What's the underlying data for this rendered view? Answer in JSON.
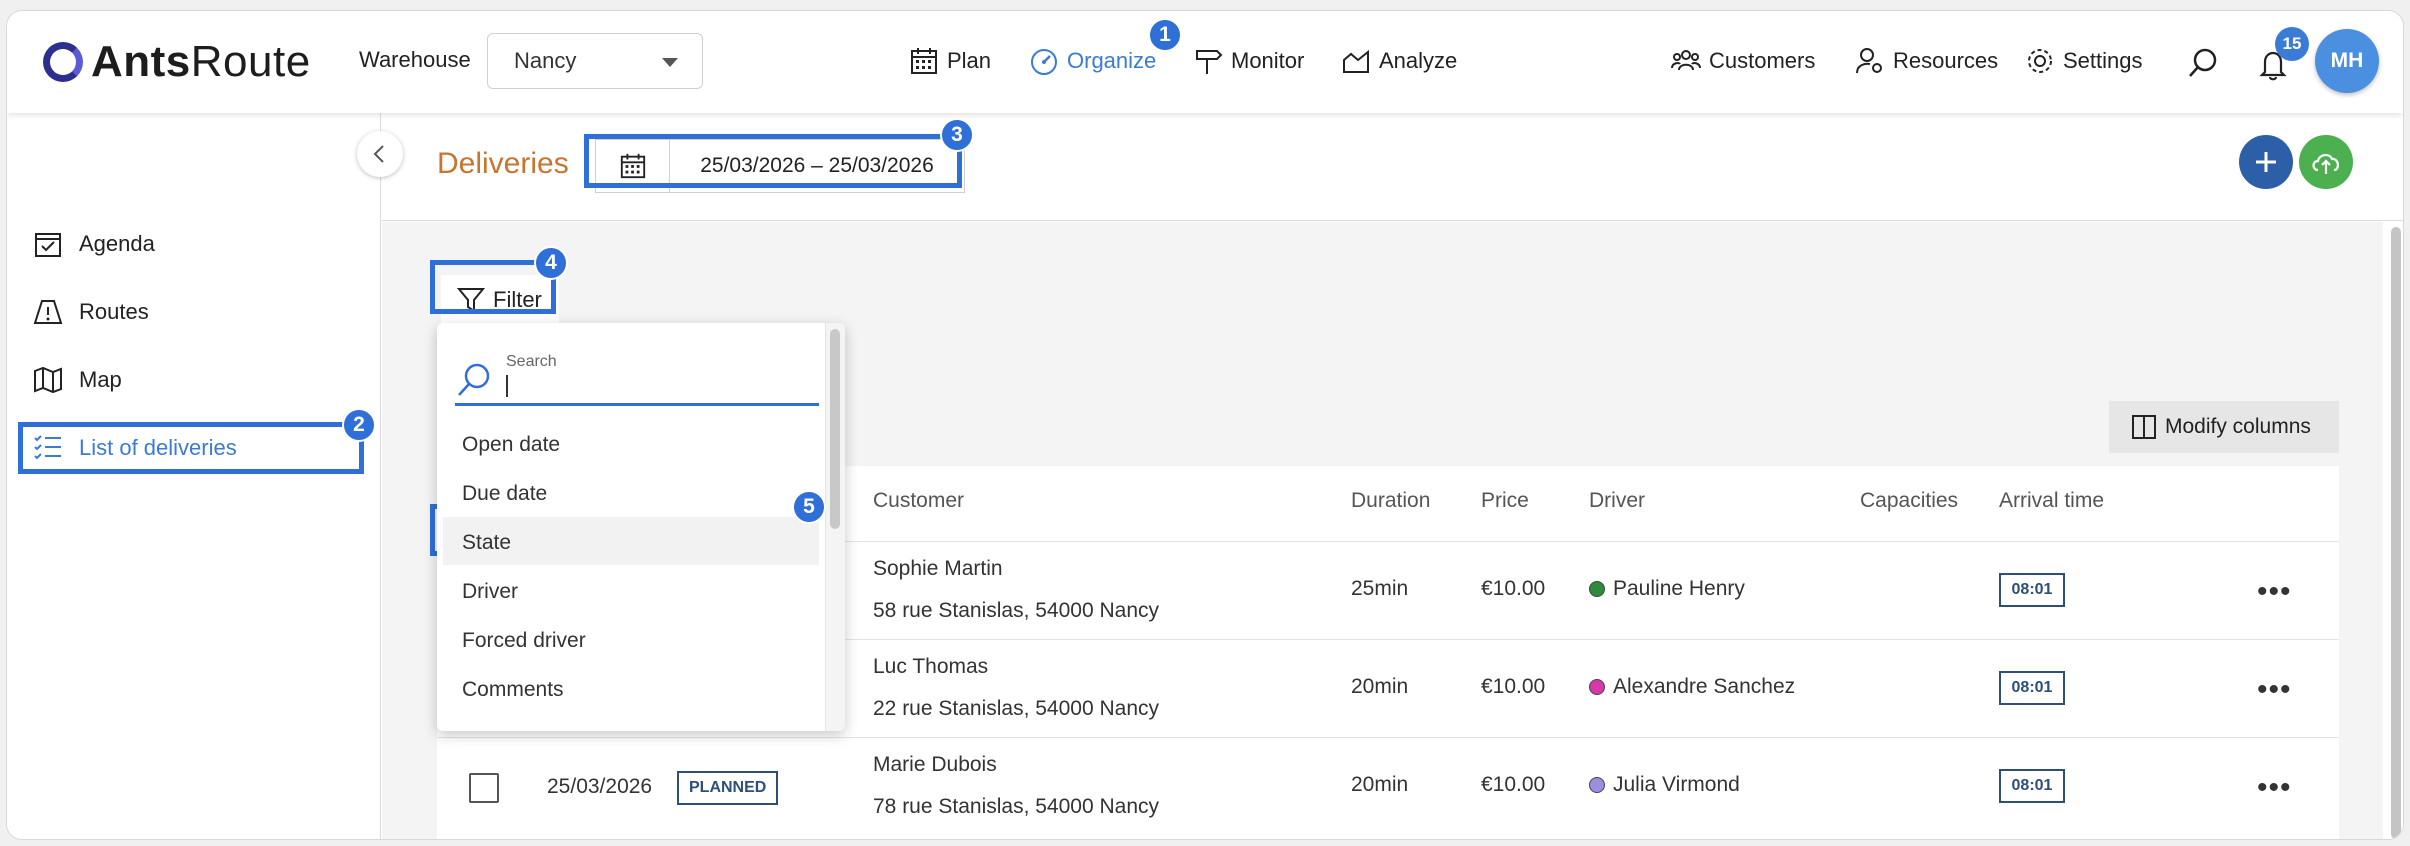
{
  "app": {
    "logo_bold": "Ants",
    "logo_light": "Route"
  },
  "warehouse": {
    "label": "Warehouse",
    "value": "Nancy"
  },
  "nav": {
    "plan": "Plan",
    "organize": "Organize",
    "monitor": "Monitor",
    "analyze": "Analyze",
    "customers": "Customers",
    "resources": "Resources",
    "settings": "Settings"
  },
  "notifications": {
    "count": "15"
  },
  "user": {
    "initials": "MH"
  },
  "sidebar": {
    "items": [
      {
        "label": "Agenda"
      },
      {
        "label": "Routes"
      },
      {
        "label": "Map"
      },
      {
        "label": "List of deliveries"
      }
    ]
  },
  "page": {
    "title": "Deliveries",
    "date_range": "25/03/2026 – 25/03/2026"
  },
  "filter": {
    "label": "Filter",
    "search_label": "Search",
    "options": [
      "Open date",
      "Due date",
      "State",
      "Driver",
      "Forced driver",
      "Comments"
    ]
  },
  "modify_columns": "Modify columns",
  "table": {
    "headers": {
      "customer": "Customer",
      "duration": "Duration",
      "price": "Price",
      "driver": "Driver",
      "capacities": "Capacities",
      "arrival": "Arrival time"
    },
    "rows": [
      {
        "date": "",
        "state": "",
        "name": "Sophie Martin",
        "address": "58 rue Stanislas, 54000 Nancy",
        "duration": "25min",
        "price": "€10.00",
        "driver": "Pauline Henry",
        "driver_color": "#2e8b3a",
        "arrival": "08:01"
      },
      {
        "date": "",
        "state": "",
        "name": "Luc Thomas",
        "address": "22 rue Stanislas, 54000 Nancy",
        "duration": "20min",
        "price": "€10.00",
        "driver": "Alexandre Sanchez",
        "driver_color": "#d63aa8",
        "arrival": "08:01"
      },
      {
        "date": "25/03/2026",
        "state": "PLANNED",
        "name": "Marie Dubois",
        "address": "78 rue Stanislas, 54000 Nancy",
        "duration": "20min",
        "price": "€10.00",
        "driver": "Julia Virmond",
        "driver_color": "#9d8fe0",
        "arrival": "08:01"
      }
    ]
  },
  "annotations": [
    "1",
    "2",
    "3",
    "4",
    "5"
  ],
  "colors": {
    "accent": "#3a7bd5",
    "highlight": "#2f6fd8",
    "title": "#c7752f",
    "add_button": "#2d5ea8",
    "upload_button": "#4caf50"
  }
}
